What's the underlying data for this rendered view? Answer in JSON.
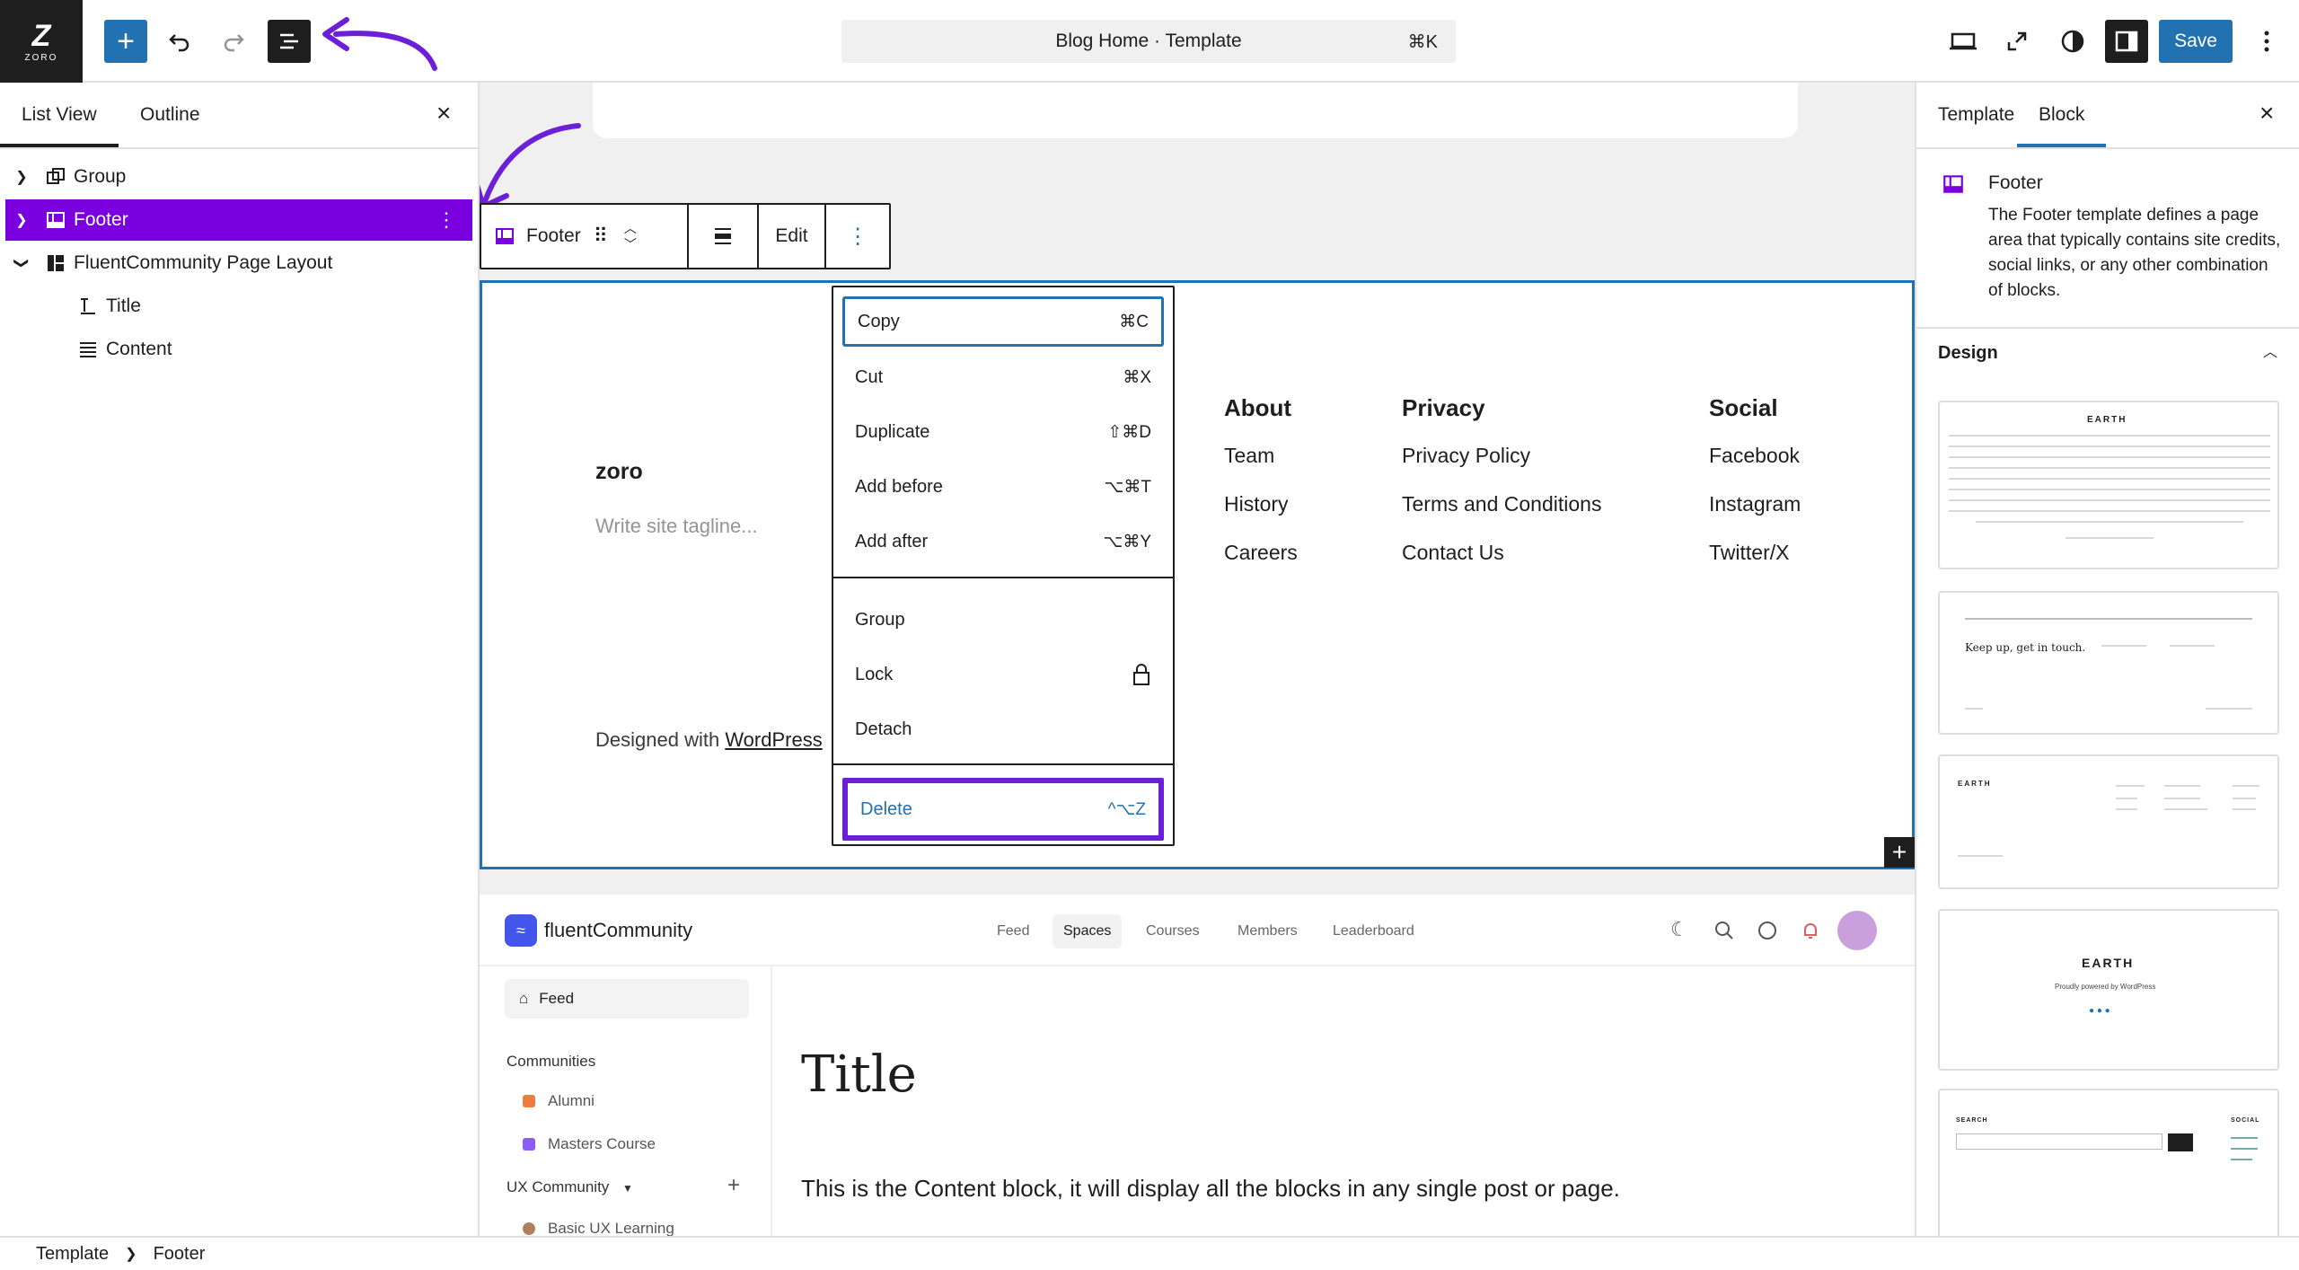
{
  "topbar": {
    "logo_text": "ZORO",
    "command_title": "Blog Home · Template",
    "command_shortcut": "⌘K",
    "save_label": "Save"
  },
  "left_panel": {
    "tabs": [
      "List View",
      "Outline"
    ],
    "items": [
      {
        "label": "Group"
      },
      {
        "label": "Footer"
      },
      {
        "label": "FluentCommunity Page Layout"
      },
      {
        "label": "Title"
      },
      {
        "label": "Content"
      }
    ]
  },
  "block_toolbar": {
    "block_name": "Footer",
    "edit_label": "Edit"
  },
  "footer_block": {
    "site_title": "zoro",
    "tagline_placeholder": "Write site tagline...",
    "designed_prefix": "Designed with ",
    "designed_link": "WordPress",
    "columns": [
      {
        "heading": "About",
        "links": [
          "Team",
          "History",
          "Careers"
        ]
      },
      {
        "heading": "Privacy",
        "links": [
          "Privacy Policy",
          "Terms and Conditions",
          "Contact Us"
        ]
      },
      {
        "heading": "Social",
        "links": [
          "Facebook",
          "Instagram",
          "Twitter/X"
        ]
      }
    ]
  },
  "context_menu": {
    "items": [
      {
        "label": "Copy",
        "shortcut": "⌘C"
      },
      {
        "label": "Cut",
        "shortcut": "⌘X"
      },
      {
        "label": "Duplicate",
        "shortcut": "⇧⌘D"
      },
      {
        "label": "Add before",
        "shortcut": "⌥⌘T"
      },
      {
        "label": "Add after",
        "shortcut": "⌥⌘Y"
      },
      {
        "label": "Group",
        "shortcut": ""
      },
      {
        "label": "Lock",
        "shortcut": ""
      },
      {
        "label": "Detach",
        "shortcut": ""
      },
      {
        "label": "Delete",
        "shortcut": "^⌥Z"
      }
    ]
  },
  "fluent_community": {
    "brand": "fluentCommunity",
    "nav": [
      "Feed",
      "Spaces",
      "Courses",
      "Members",
      "Leaderboard"
    ],
    "sidebar": {
      "feed": "Feed",
      "communities_label": "Communities",
      "communities": [
        "Alumni",
        "Masters Course"
      ],
      "ux_label": "UX Community",
      "ux_items": [
        "Basic UX Learning"
      ]
    },
    "title": "Title",
    "content_text": "This is the Content block, it will display all the blocks in any single post or page."
  },
  "right_panel": {
    "tabs": [
      "Template",
      "Block"
    ],
    "block_title": "Footer",
    "block_description": "The Footer template defines a page area that typically contains site credits, social links, or any other combination of blocks.",
    "design_label": "Design",
    "previews": [
      {
        "title": "EARTH"
      },
      {
        "title": "Keep up, get in touch."
      },
      {
        "title": "EARTH"
      },
      {
        "title": "EARTH",
        "sub": "Proudly powered by WordPress"
      },
      {
        "title": "SEARCH",
        "sub": "SOCIAL"
      }
    ]
  },
  "status_bar": {
    "crumbs": [
      "Template",
      "Footer"
    ]
  },
  "colors": {
    "accent": "#2271b1",
    "selection": "#7a00df",
    "annotation_arrow": "#6b1fd6"
  }
}
